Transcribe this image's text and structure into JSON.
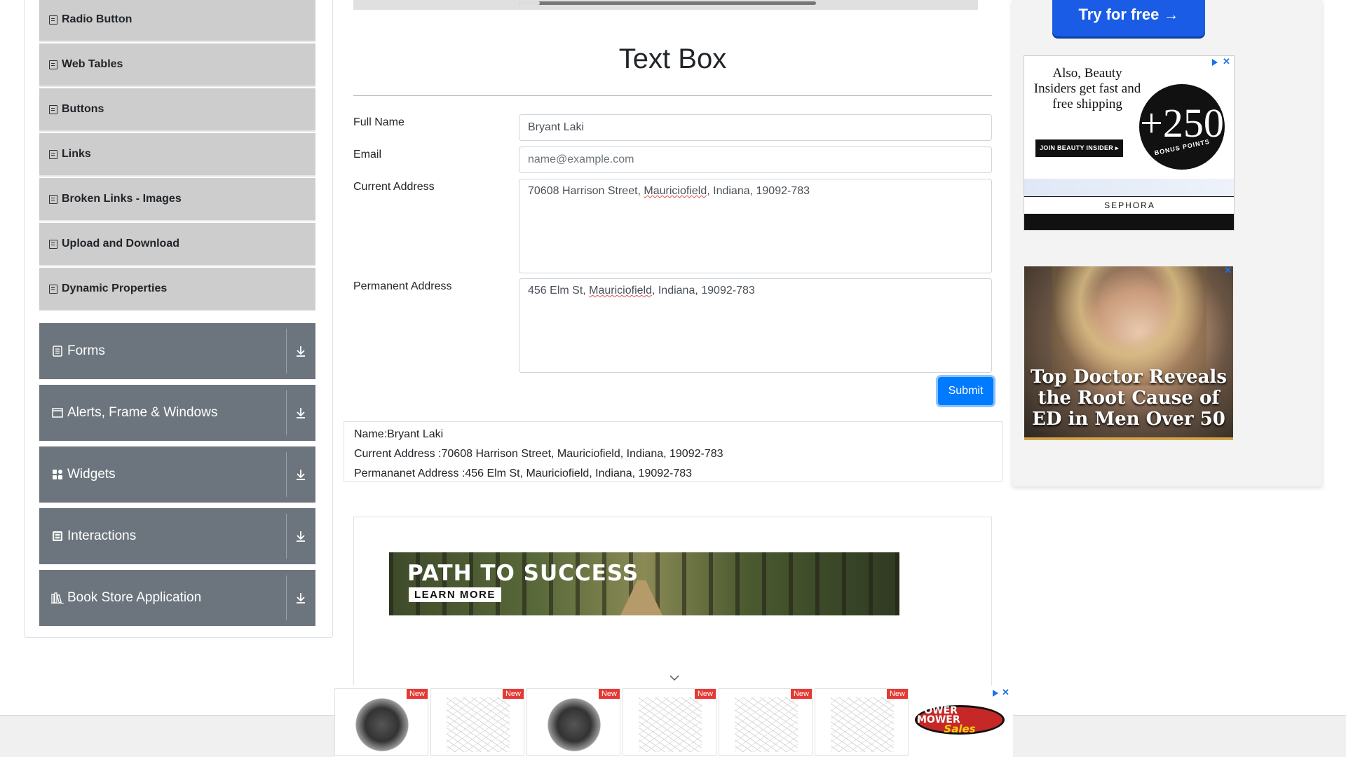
{
  "sidebar": {
    "sub_items": [
      {
        "label": "Radio Button"
      },
      {
        "label": "Web Tables"
      },
      {
        "label": "Buttons"
      },
      {
        "label": "Links"
      },
      {
        "label": "Broken Links - Images"
      },
      {
        "label": "Upload and Download"
      },
      {
        "label": "Dynamic Properties"
      }
    ],
    "groups": [
      {
        "label": "Forms",
        "icon": "form-icon"
      },
      {
        "label": "Alerts, Frame & Windows",
        "icon": "window-icon"
      },
      {
        "label": "Widgets",
        "icon": "widgets-icon"
      },
      {
        "label": "Interactions",
        "icon": "interactions-icon"
      },
      {
        "label": "Book Store Application",
        "icon": "book-store-icon"
      }
    ]
  },
  "main": {
    "title": "Text Box",
    "form": {
      "full_name": {
        "label": "Full Name",
        "value": "Bryant Laki"
      },
      "email": {
        "label": "Email",
        "value": "",
        "placeholder": "name@example.com"
      },
      "current_address": {
        "label": "Current Address",
        "value_prefix": "70608 Harrison Street, ",
        "value_sq": "Mauriciofield",
        "value_suffix": ", Indiana, 19092-783"
      },
      "permanent_address": {
        "label": "Permanent Address",
        "value_prefix": "456 Elm St, ",
        "value_sq": "Mauriciofield",
        "value_suffix": ", Indiana, 19092-783"
      },
      "submit_label": "Submit"
    },
    "output": {
      "name": "Name:Bryant Laki",
      "current_address": "Current Address :70608 Harrison Street, Mauriciofield, Indiana, 19092-783",
      "permanent_address": "Permananet Address :456 Elm St, Mauriciofield, Indiana, 19092-783"
    }
  },
  "ads": {
    "banner": {
      "headline": "PATH TO SUCCESS",
      "cta": "LEARN MORE"
    },
    "try_button": "Try for free →",
    "sephora": {
      "copy": "Also, Beauty Insiders get fast and free shipping",
      "cta": "JOIN BEAUTY INSIDER ▸",
      "badge_number": "+250",
      "badge_text": "BONUS POINTS",
      "brand": "SEPHORA"
    },
    "doctor": {
      "headline": "Top Doctor Reveals the Root Cause of ED in Men Over 50"
    },
    "bottom": {
      "new_label": "New",
      "logo_top": "POWER MOWER",
      "logo_bottom": "Sales"
    }
  },
  "colors": {
    "accent": "#007bff",
    "sidebar_group": "#6c757d",
    "sidebar_item": "#cdcdcd"
  }
}
